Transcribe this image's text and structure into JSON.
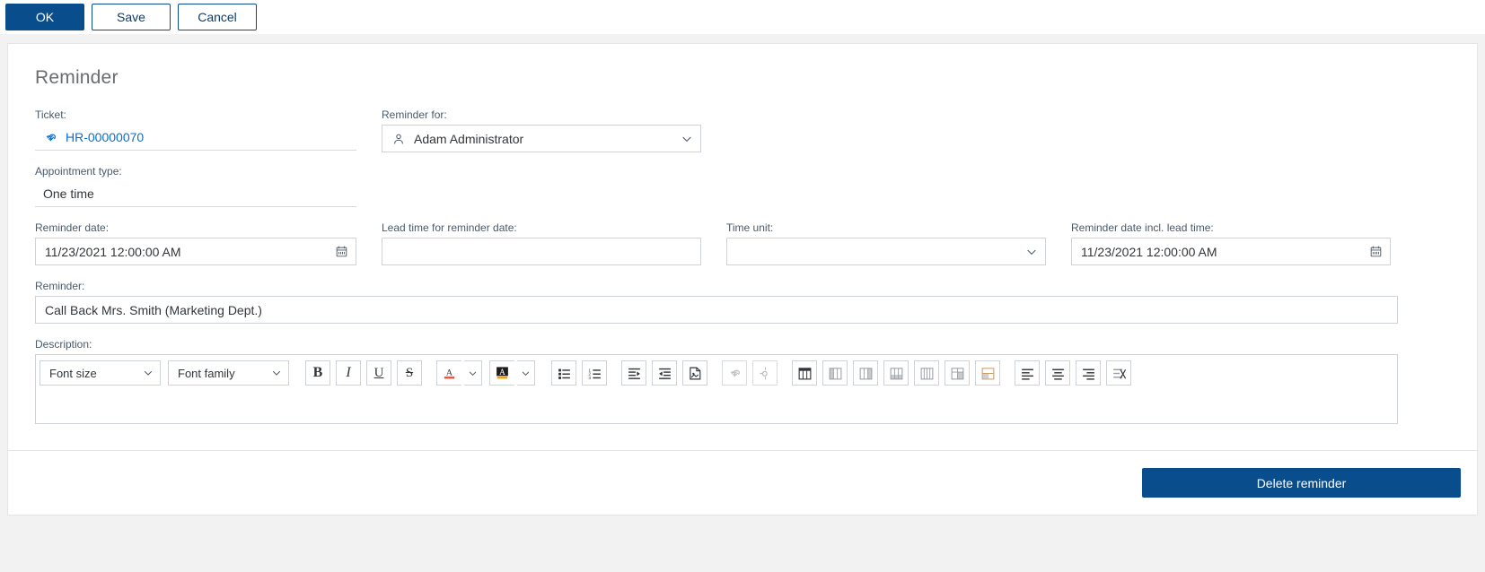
{
  "toolbar": {
    "ok_label": "OK",
    "save_label": "Save",
    "cancel_label": "Cancel"
  },
  "form": {
    "title": "Reminder",
    "ticket": {
      "label": "Ticket:",
      "value": "HR-00000070",
      "icon": "chain-link-icon"
    },
    "reminder_for": {
      "label": "Reminder for:",
      "value": "Adam Administrator",
      "icon": "person-icon"
    },
    "appointment_type": {
      "label": "Appointment type:",
      "value": "One time"
    },
    "reminder_date": {
      "label": "Reminder date:",
      "value": "11/23/2021 12:00:00 AM",
      "icon": "calendar-icon"
    },
    "lead_time": {
      "label": "Lead time for reminder date:",
      "value": ""
    },
    "time_unit": {
      "label": "Time unit:",
      "value": ""
    },
    "reminder_date_incl_lead": {
      "label": "Reminder date incl. lead time:",
      "value": "11/23/2021 12:00:00 AM",
      "icon": "calendar-icon"
    },
    "reminder": {
      "label": "Reminder:",
      "value": "Call Back  Mrs. Smith (Marketing Dept.)"
    },
    "description": {
      "label": "Description:",
      "body_text": ""
    }
  },
  "editor_toolbar": {
    "font_size_label": "Font size",
    "font_family_label": "Font family",
    "buttons": [
      {
        "name": "bold-icon",
        "glyph": "B"
      },
      {
        "name": "italic-icon",
        "glyph": "I"
      },
      {
        "name": "underline-icon",
        "glyph": "U"
      },
      {
        "name": "strikethrough-icon",
        "glyph": "S"
      },
      {
        "name": "font-color-icon",
        "glyph": "A"
      },
      {
        "name": "highlight-color-icon",
        "glyph": "A"
      },
      {
        "name": "bullet-list-icon",
        "glyph": ""
      },
      {
        "name": "numbered-list-icon",
        "glyph": ""
      },
      {
        "name": "indent-icon",
        "glyph": ""
      },
      {
        "name": "outdent-icon",
        "glyph": ""
      },
      {
        "name": "insert-image-icon",
        "glyph": ""
      },
      {
        "name": "insert-link-icon",
        "glyph": ""
      },
      {
        "name": "unlink-icon",
        "glyph": ""
      },
      {
        "name": "insert-table-icon",
        "glyph": ""
      },
      {
        "name": "table-column-left-icon",
        "glyph": ""
      },
      {
        "name": "table-column-right-icon",
        "glyph": ""
      },
      {
        "name": "table-delete-column-icon",
        "glyph": ""
      },
      {
        "name": "table-row-icon",
        "glyph": ""
      },
      {
        "name": "table-split-icon",
        "glyph": ""
      },
      {
        "name": "table-merge-icon",
        "glyph": ""
      },
      {
        "name": "align-left-icon",
        "glyph": ""
      },
      {
        "name": "align-center-icon",
        "glyph": ""
      },
      {
        "name": "align-right-icon",
        "glyph": ""
      },
      {
        "name": "clear-formatting-icon",
        "glyph": ""
      }
    ]
  },
  "footer": {
    "delete_label": "Delete reminder"
  },
  "colors": {
    "primary": "#0a4d8c",
    "link": "#0a6ed1",
    "label": "#4a5a6a",
    "title": "#6a6d70",
    "border": "#cdd3d8"
  }
}
